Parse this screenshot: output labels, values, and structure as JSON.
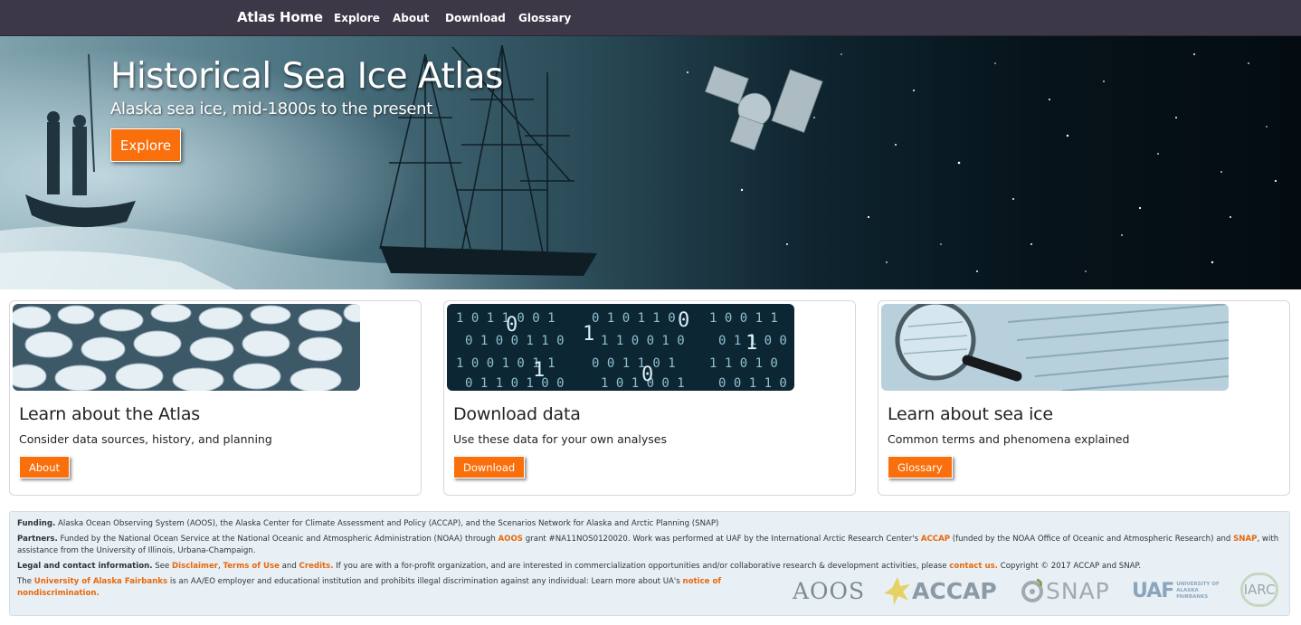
{
  "nav": {
    "brand": "Atlas Home",
    "links": [
      "Explore",
      "About",
      "Download",
      "Glossary"
    ]
  },
  "hero": {
    "title": "Historical Sea Ice Atlas",
    "subtitle": "Alaska sea ice, mid-1800s to the present",
    "button": "Explore"
  },
  "cards": [
    {
      "title": "Learn about the Atlas",
      "description": "Consider data sources, history, and planning",
      "button": "About"
    },
    {
      "title": "Download data",
      "description": "Use these data for your own analyses",
      "button": "Download"
    },
    {
      "title": "Learn about sea ice",
      "description": "Common terms and phenomena explained",
      "button": "Glossary"
    }
  ],
  "footer": {
    "funding_label": "Funding.",
    "funding_text": "Alaska Ocean Observing System (AOOS), the Alaska Center for Climate Assessment and Policy (ACCAP), and the Scenarios Network for Alaska and Arctic Planning (SNAP)",
    "partners_label": "Partners.",
    "partners_text_1": "Funded by the National Ocean Service at the National Oceanic and Atmospheric Administration (NOAA) through",
    "partners_link_aoos": "AOOS",
    "partners_text_2": "grant #NA11NOS0120020. Work was performed at UAF by the International Arctic Research Center's",
    "partners_link_accap": "ACCAP",
    "partners_text_3": "(funded by the NOAA Office of Oceanic and Atmospheric Research) and",
    "partners_link_snap": "SNAP",
    "partners_text_4": ", with",
    "partners_text_5": "assistance from the University of Illinois, Urbana-Champaign.",
    "legal_label": "Legal and contact information.",
    "legal_text_1": "See",
    "legal_link_disclaimer": "Disclaimer",
    "legal_link_terms": "Terms of Use",
    "legal_text_and": "and",
    "legal_link_credits": "Credits.",
    "legal_text_2": "If you are with a for-profit organization, and are interested in commercialization opportunities and/or collaborative research & development activities, please",
    "legal_link_contact": "contact us.",
    "legal_text_3": "Copyright © 2017 ACCAP and SNAP.",
    "uaf_text_1": "The",
    "uaf_link": "University of Alaska Fairbanks",
    "uaf_text_2": "is an AA/EO employer and educational institution and prohibits illegal discrimination against any individual: Learn more about UA's",
    "uaf_link_notice_1": "notice of",
    "uaf_link_notice_2": "nondiscrimination.",
    "logos": [
      "AOOS",
      "ACCAP",
      "SNAP",
      "UAF",
      "UNIVERSITY OF ALASKA FAIRBANKS",
      "IARC"
    ]
  },
  "colors": {
    "accent": "#f96f0c",
    "navbar": "#3d3847",
    "footer_bg": "#e8f0f5"
  }
}
